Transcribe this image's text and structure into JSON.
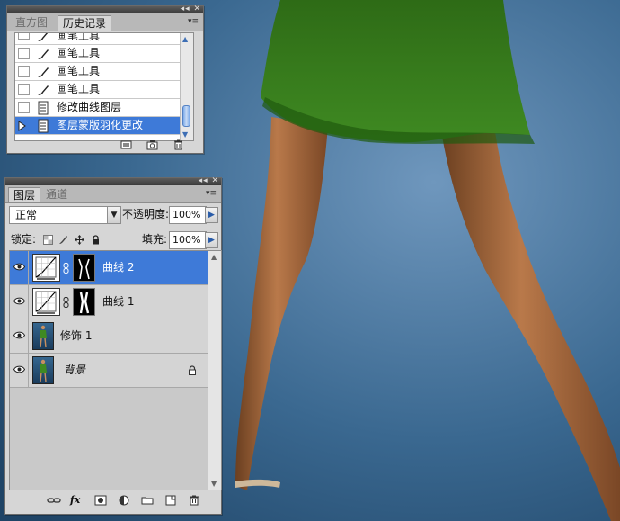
{
  "history_panel": {
    "tabs": [
      {
        "label": "直方图",
        "active": false
      },
      {
        "label": "历史记录",
        "active": true
      }
    ],
    "items": [
      {
        "label": "画笔工具",
        "icon": "brush-icon",
        "selected": false
      },
      {
        "label": "画笔工具",
        "icon": "brush-icon",
        "selected": false
      },
      {
        "label": "画笔工具",
        "icon": "brush-icon",
        "selected": false
      },
      {
        "label": "画笔工具",
        "icon": "brush-icon",
        "selected": false
      },
      {
        "label": "修改曲线图层",
        "icon": "document-icon",
        "selected": false
      },
      {
        "label": "图层蒙版羽化更改",
        "icon": "document-icon",
        "selected": true
      }
    ],
    "footer_icons": [
      "new-document-from-state-icon",
      "snapshot-camera-icon",
      "trash-icon"
    ]
  },
  "layers_panel": {
    "tabs": [
      {
        "label": "图层",
        "active": true
      },
      {
        "label": "通道",
        "active": false
      }
    ],
    "blend_mode": "正常",
    "opacity_label": "不透明度:",
    "opacity_value": "100%",
    "lock_label": "锁定:",
    "fill_label": "填充:",
    "fill_value": "100%",
    "layers": [
      {
        "name": "曲线 2",
        "type": "adjustment-curves",
        "has_mask": true,
        "selected": true,
        "locked": false
      },
      {
        "name": "曲线 1",
        "type": "adjustment-curves",
        "has_mask": true,
        "selected": false,
        "locked": false
      },
      {
        "name": "修饰 1",
        "type": "pixel",
        "has_mask": false,
        "selected": false,
        "locked": false
      },
      {
        "name": "背景",
        "type": "pixel",
        "has_mask": false,
        "selected": false,
        "locked": true
      }
    ],
    "footer_icons": [
      "link-layers-icon",
      "fx-icon",
      "add-mask-icon",
      "adjustment-layer-icon",
      "group-folder-icon",
      "new-layer-icon",
      "trash-icon"
    ],
    "fx_label": "fx"
  },
  "colors": {
    "selection_blue": "#3e7ad8",
    "panel_gray": "#d6d6d6",
    "backdrop_blue": "#2d5a7f",
    "dress_green": "#2f7b1a"
  }
}
